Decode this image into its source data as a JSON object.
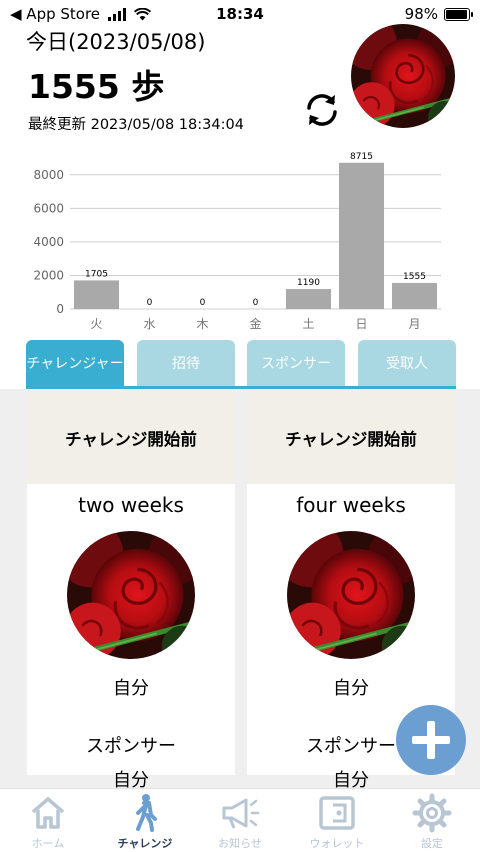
{
  "status_bar": {
    "back_label": "◀ App Store",
    "time": "18:34",
    "battery": "98%"
  },
  "header": {
    "date_label": "今日(2023/05/08)",
    "steps": "1555 歩",
    "last_update": "最終更新 2023/05/08 18:34:04"
  },
  "chart_data": {
    "type": "bar",
    "categories": [
      "火",
      "水",
      "木",
      "金",
      "土",
      "日",
      "月"
    ],
    "values": [
      1705,
      0,
      0,
      0,
      1190,
      8715,
      1555
    ],
    "ylim": [
      0,
      9000
    ],
    "yticks": [
      0,
      2000,
      4000,
      6000,
      8000
    ],
    "grid": true,
    "bar_color": "#a9a9a9"
  },
  "tabs": [
    {
      "label": "チャレンジャー",
      "active": true
    },
    {
      "label": "招待",
      "active": false
    },
    {
      "label": "スポンサー",
      "active": false
    },
    {
      "label": "受取人",
      "active": false
    }
  ],
  "cards": [
    {
      "status": "チャレンジ開始前",
      "duration": "two weeks",
      "owner": "自分",
      "sponsor_label": "スポンサー",
      "sponsor": "自分"
    },
    {
      "status": "チャレンジ開始前",
      "duration": "four weeks",
      "owner": "自分",
      "sponsor_label": "スポンサー",
      "sponsor": "自分"
    }
  ],
  "fab_icon": "plus-icon",
  "nav": [
    {
      "label": "ホーム",
      "icon": "home-icon",
      "active": false
    },
    {
      "label": "チャレンジ",
      "icon": "walking-person-icon",
      "active": true
    },
    {
      "label": "お知らせ",
      "icon": "megaphone-icon",
      "active": false
    },
    {
      "label": "ウォレット",
      "icon": "wallet-icon",
      "active": false
    },
    {
      "label": "設定",
      "icon": "gear-icon",
      "active": false
    }
  ],
  "colors": {
    "accent": "#3aaed0",
    "tab_inactive": "#a9d8e2",
    "fab": "#6b9fd2",
    "nav_active": "#2a3c5c",
    "nav_inactive": "#b8c6d4"
  }
}
